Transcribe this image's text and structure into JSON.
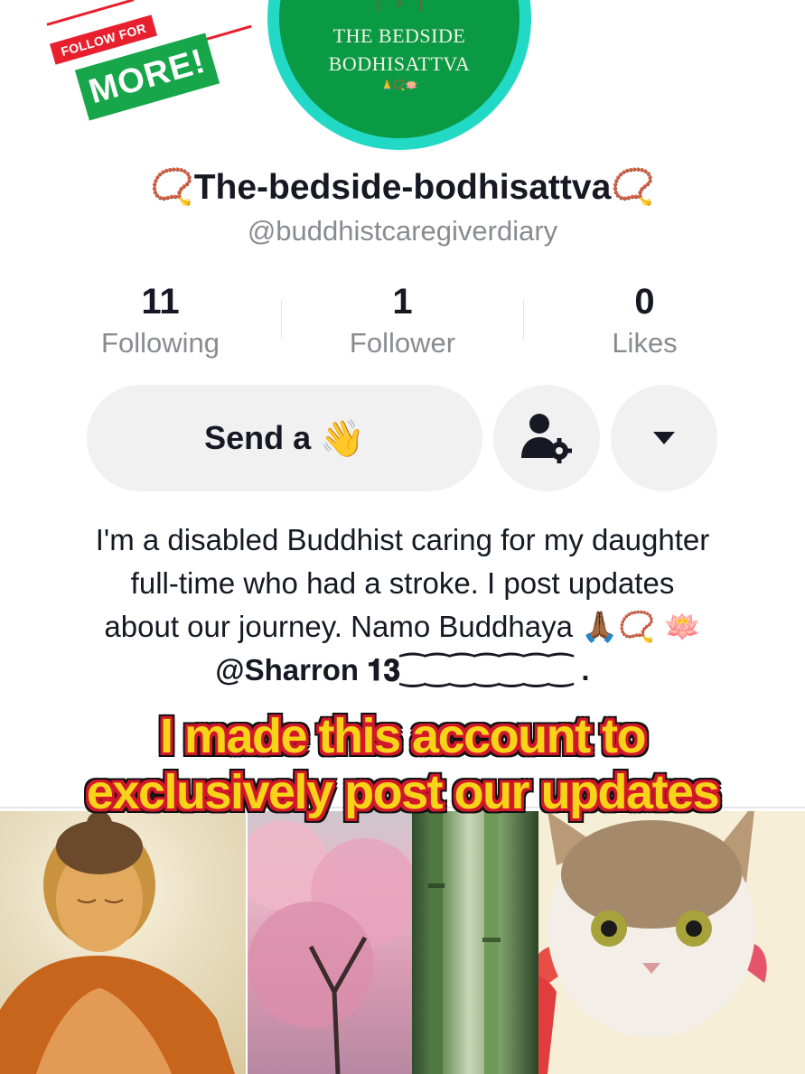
{
  "sticker": {
    "top_text": "FOLLOW FOR",
    "main_text": "MORE!"
  },
  "avatar": {
    "line1": "THE BEDSIDE",
    "line2": "BODHISATTVA",
    "tiny": "🙏📿🪷"
  },
  "profile": {
    "display_name": "📿The-bedside-bodhisattva📿",
    "handle": "@buddhistcaregiverdiary"
  },
  "stats": [
    {
      "value": "11",
      "label": "Following"
    },
    {
      "value": "1",
      "label": "Follower"
    },
    {
      "value": "0",
      "label": "Likes"
    }
  ],
  "actions": {
    "wave_label": "Send a",
    "wave_emoji": "👋"
  },
  "bio": {
    "line1": "I'm a disabled Buddhist caring for my daughter",
    "line2": "full-time who had a stroke. I post updates",
    "line3": "about our journey. Namo Buddhaya 🙏🏾📿 🪷",
    "mention": "@Sharron 𝟏𝟑⁐⁐⁐⁐⁐⁐⁐ ."
  },
  "caption": {
    "line1": "I made this account to",
    "line2": "exclusively post our updates"
  },
  "colors": {
    "accent_green": "#17a64a",
    "accent_red": "#e8202e",
    "ring": "#21d9c5",
    "caption_yellow": "#f7d417"
  }
}
